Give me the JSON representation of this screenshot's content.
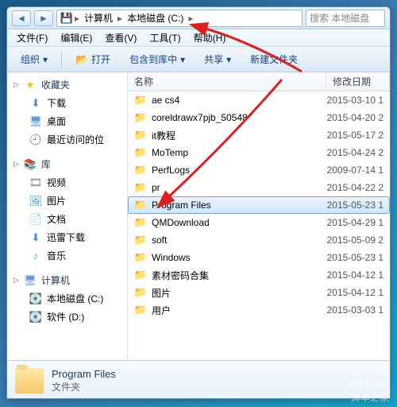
{
  "breadcrumb": {
    "computer": "计算机",
    "drive": "本地磁盘 (C:)"
  },
  "search_placeholder": "搜索 本地磁盘",
  "menu": {
    "file": "文件(F)",
    "edit": "编辑(E)",
    "view": "查看(V)",
    "tools": "工具(T)",
    "help": "帮助(H)"
  },
  "toolbar": {
    "organize": "组织",
    "open": "打开",
    "include": "包含到库中",
    "share": "共享",
    "newfolder": "新建文件夹"
  },
  "nav": {
    "favorites": "收藏夹",
    "downloads": "下载",
    "desktop": "桌面",
    "recent": "最近访问的位",
    "libraries": "库",
    "videos": "视频",
    "pictures": "图片",
    "documents": "文档",
    "thunder": "迅雷下载",
    "music": "音乐",
    "computer": "计算机",
    "drive_c": "本地磁盘 (C:)",
    "drive_d": "软件 (D:)"
  },
  "columns": {
    "name": "名称",
    "date": "修改日期"
  },
  "files": [
    {
      "name": "ae cs4",
      "date": "2015-03-10 1"
    },
    {
      "name": "coreldrawx7pjb_50548",
      "date": "2015-04-20 2"
    },
    {
      "name": "it教程",
      "date": "2015-05-17 2"
    },
    {
      "name": "MoTemp",
      "date": "2015-04-24 2"
    },
    {
      "name": "PerfLogs",
      "date": "2009-07-14 1"
    },
    {
      "name": "pr",
      "date": "2015-04-22 2"
    },
    {
      "name": "Program Files",
      "date": "2015-05-23 1",
      "selected": true
    },
    {
      "name": "QMDownload",
      "date": "2015-04-29 1"
    },
    {
      "name": "soft",
      "date": "2015-05-09 2"
    },
    {
      "name": "Windows",
      "date": "2015-05-23 1"
    },
    {
      "name": "素材密码合集",
      "date": "2015-04-12 1"
    },
    {
      "name": "图片",
      "date": "2015-04-12 1"
    },
    {
      "name": "用户",
      "date": "2015-03-03 1"
    }
  ],
  "details": {
    "name": "Program Files",
    "type": "文件夹"
  },
  "watermark": {
    "site": "jb51.net",
    "name": "脚本之家"
  }
}
